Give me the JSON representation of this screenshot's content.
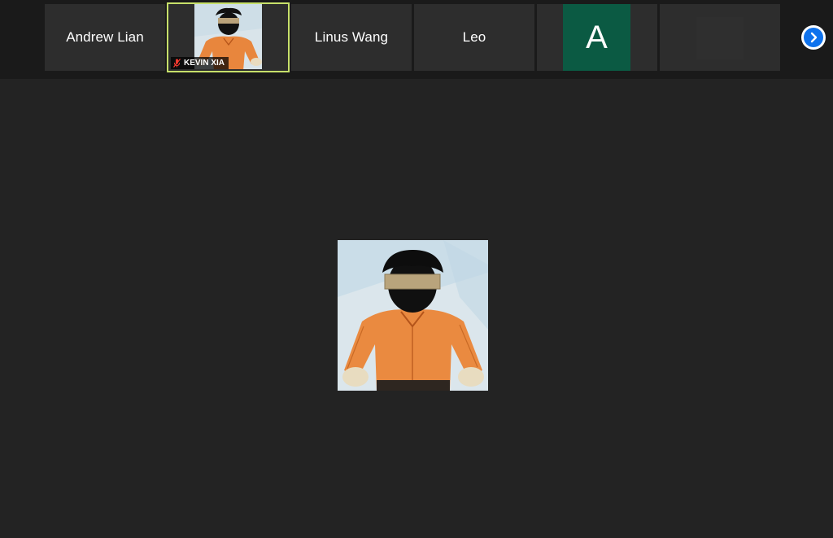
{
  "participants": [
    {
      "name": "Andrew Lian",
      "type": "name-only"
    },
    {
      "name": "KEVIN XIA",
      "type": "video",
      "muted": true,
      "active": true
    },
    {
      "name": "Linus Wang",
      "type": "name-only"
    },
    {
      "name": "Leo",
      "type": "name-only"
    },
    {
      "initial": "A",
      "type": "avatar",
      "color": "#0b5a43"
    },
    {
      "type": "blank"
    }
  ],
  "controls": {
    "next_icon": "chevron-right-icon"
  },
  "colors": {
    "active_border": "#c7e06a",
    "accent_blue": "#0e72ed",
    "avatar_green": "#0b5a43"
  }
}
